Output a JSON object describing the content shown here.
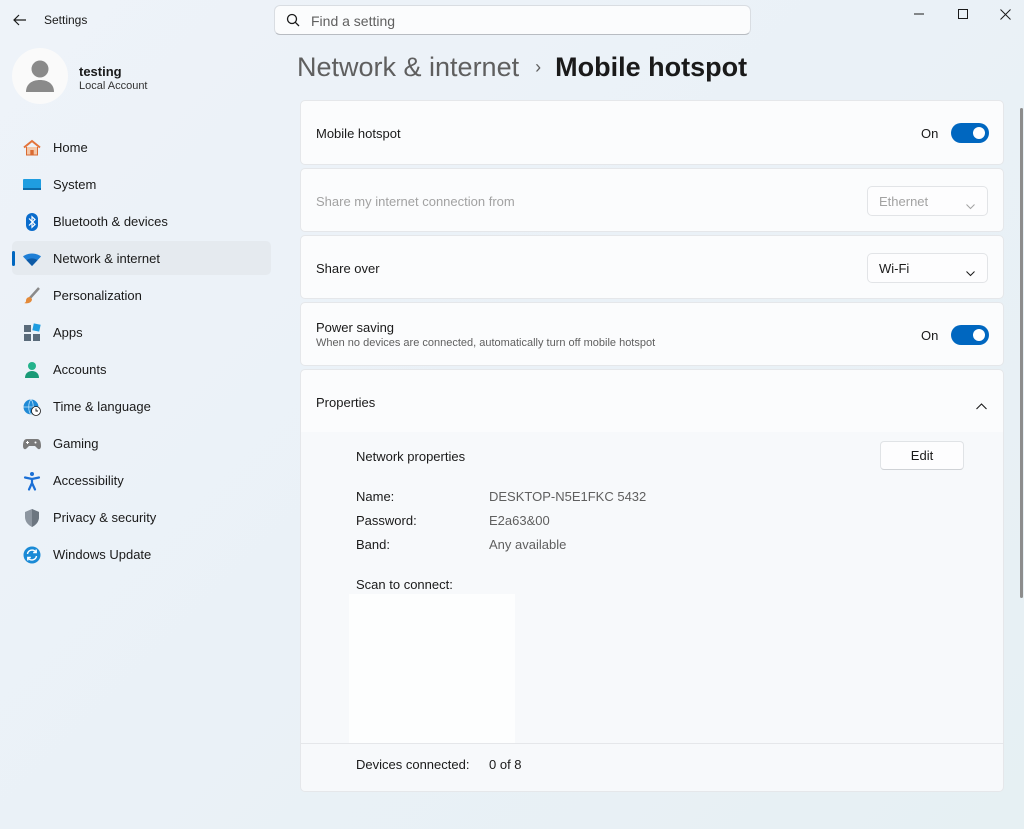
{
  "window": {
    "app_title": "Settings"
  },
  "search": {
    "placeholder": "Find a setting"
  },
  "profile": {
    "name": "testing",
    "account_type": "Local Account"
  },
  "sidebar": {
    "items": [
      {
        "label": "Home",
        "icon": "home-icon"
      },
      {
        "label": "System",
        "icon": "system-icon"
      },
      {
        "label": "Bluetooth & devices",
        "icon": "bluetooth-icon"
      },
      {
        "label": "Network & internet",
        "icon": "wifi-icon",
        "active": true
      },
      {
        "label": "Personalization",
        "icon": "brush-icon"
      },
      {
        "label": "Apps",
        "icon": "apps-icon"
      },
      {
        "label": "Accounts",
        "icon": "person-icon"
      },
      {
        "label": "Time & language",
        "icon": "globe-clock-icon"
      },
      {
        "label": "Gaming",
        "icon": "gamepad-icon"
      },
      {
        "label": "Accessibility",
        "icon": "accessibility-icon"
      },
      {
        "label": "Privacy & security",
        "icon": "shield-icon"
      },
      {
        "label": "Windows Update",
        "icon": "update-icon"
      }
    ]
  },
  "breadcrumb": {
    "parent": "Network & internet",
    "separator": "›",
    "current": "Mobile hotspot"
  },
  "hotspot": {
    "label": "Mobile hotspot",
    "state": "On"
  },
  "share_from": {
    "label": "Share my internet connection from",
    "value": "Ethernet",
    "disabled": true
  },
  "share_over": {
    "label": "Share over",
    "value": "Wi-Fi"
  },
  "power_saving": {
    "label": "Power saving",
    "description": "When no devices are connected, automatically turn off mobile hotspot",
    "state": "On"
  },
  "properties": {
    "label": "Properties",
    "network_properties_label": "Network properties",
    "edit_label": "Edit",
    "name_label": "Name:",
    "name_value": "DESKTOP-N5E1FKC 5432",
    "password_label": "Password:",
    "password_value": "E2a63&00",
    "band_label": "Band:",
    "band_value": "Any available",
    "scan_label": "Scan to connect:",
    "devices_label": "Devices connected:",
    "devices_value": "0 of 8"
  },
  "colors": {
    "accent": "#0067c0"
  }
}
